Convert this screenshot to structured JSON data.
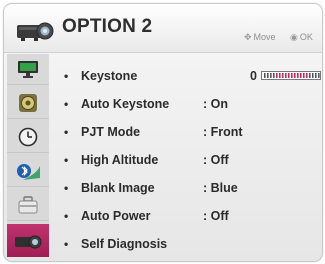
{
  "header": {
    "title": "OPTION 2",
    "icon": "projector-icon",
    "hints": {
      "move": "Move",
      "ok": "OK"
    }
  },
  "sidebar": {
    "items": [
      {
        "icon": "picture-monitor-icon",
        "active": false
      },
      {
        "icon": "speaker-icon",
        "active": false
      },
      {
        "icon": "clock-icon",
        "active": false
      },
      {
        "icon": "bluetooth-icon",
        "active": false
      },
      {
        "icon": "briefcase-icon",
        "active": false
      },
      {
        "icon": "projector-icon",
        "active": true
      }
    ]
  },
  "menu": {
    "items": [
      {
        "label": "Keystone",
        "value": "0"
      },
      {
        "label": "Auto Keystone",
        "value": ": On"
      },
      {
        "label": "PJT Mode",
        "value": ": Front"
      },
      {
        "label": "High Altitude",
        "value": ": Off"
      },
      {
        "label": "Blank Image",
        "value": ": Blue"
      },
      {
        "label": "Auto Power",
        "value": ": Off"
      },
      {
        "label": "Self Diagnosis",
        "value": ""
      }
    ],
    "keystone_slider_position": 0.5
  },
  "colors": {
    "accent": "#b02862",
    "slider_tick_active": "#c62a5c",
    "slider_tick_inactive": "#555555"
  }
}
